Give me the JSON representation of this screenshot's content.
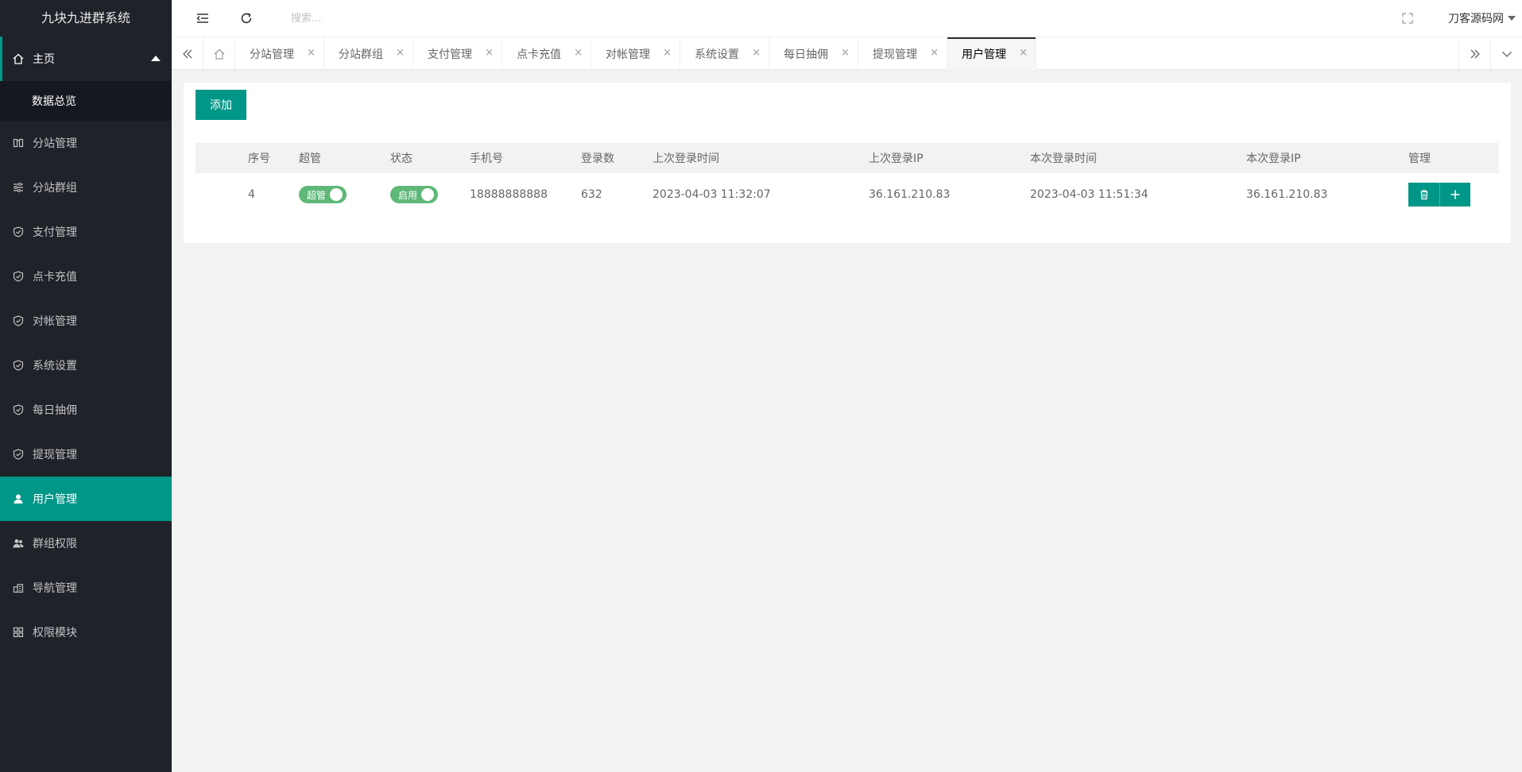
{
  "app": {
    "title": "九块九进群系统"
  },
  "sidebar": {
    "home": {
      "label": "主页"
    },
    "home_sub": {
      "label": "数据总览"
    },
    "items": [
      {
        "label": "分站管理",
        "icon": "columns-icon"
      },
      {
        "label": "分站群组",
        "icon": "sliders-icon"
      },
      {
        "label": "支付管理",
        "icon": "shield-check-icon"
      },
      {
        "label": "点卡充值",
        "icon": "shield-check-icon"
      },
      {
        "label": "对帐管理",
        "icon": "shield-check-icon"
      },
      {
        "label": "系统设置",
        "icon": "shield-check-icon"
      },
      {
        "label": "每日抽佣",
        "icon": "shield-check-icon"
      },
      {
        "label": "提现管理",
        "icon": "shield-check-icon"
      },
      {
        "label": "用户管理",
        "icon": "user-icon",
        "active": true
      },
      {
        "label": "群组权限",
        "icon": "users-icon"
      },
      {
        "label": "导航管理",
        "icon": "nav-icon"
      },
      {
        "label": "权限模块",
        "icon": "grid-icon"
      }
    ]
  },
  "header": {
    "search_placeholder": "搜索...",
    "user_name": "刀客源码网"
  },
  "tabs": [
    {
      "label": "分站管理"
    },
    {
      "label": "分站群组"
    },
    {
      "label": "支付管理"
    },
    {
      "label": "点卡充值"
    },
    {
      "label": "对帐管理"
    },
    {
      "label": "系统设置"
    },
    {
      "label": "每日抽佣"
    },
    {
      "label": "提现管理"
    },
    {
      "label": "用户管理",
      "active": true
    }
  ],
  "tab_close_glyph": "×",
  "content": {
    "add_label": "添加",
    "columns": [
      "序号",
      "超管",
      "状态",
      "手机号",
      "登录数",
      "上次登录时间",
      "上次登录IP",
      "本次登录时间",
      "本次登录IP",
      "管理"
    ],
    "rows": [
      {
        "id": "4",
        "super_admin": "超管",
        "status": "启用",
        "phone": "18888888888",
        "login_count": "632",
        "last_login_time": "2023-04-03 11:32:07",
        "last_login_ip": "36.161.210.83",
        "this_login_time": "2023-04-03 11:51:34",
        "this_login_ip": "36.161.210.83"
      }
    ]
  },
  "colors": {
    "accent": "#009688",
    "sidebar_bg": "#20222a",
    "toggle_on": "#5fb878"
  }
}
